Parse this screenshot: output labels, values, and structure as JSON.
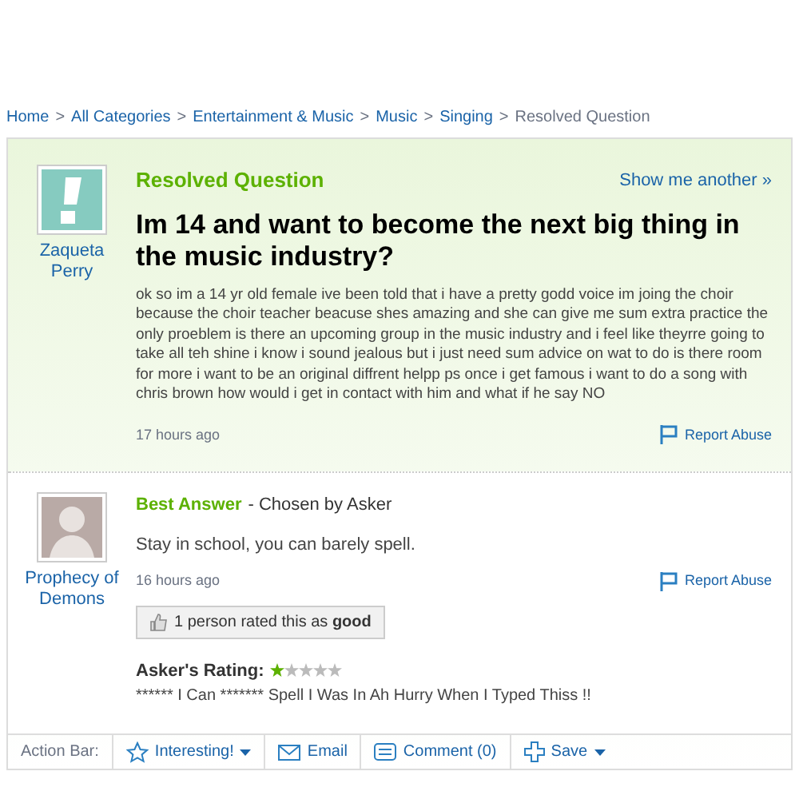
{
  "breadcrumbs": [
    {
      "label": "Home",
      "link": true
    },
    {
      "label": "All Categories",
      "link": true
    },
    {
      "label": "Entertainment & Music",
      "link": true
    },
    {
      "label": "Music",
      "link": true
    },
    {
      "label": "Singing",
      "link": true
    },
    {
      "label": "Resolved Question",
      "link": false
    }
  ],
  "separator": ">",
  "question": {
    "status": "Resolved Question",
    "show_another": "Show me another »",
    "asker": "Zaqueta Perry",
    "title": "Im 14 and want to become the next big thing in the music industry?",
    "body": "ok so im a 14 yr old female ive been told that i have a pretty godd voice im joing the choir because the choir teacher beacuse shes amazing and she can give me sum extra practice the only proeblem is there an upcoming group in the music industry and i feel like theyrre going to take all teh shine i know i sound jealous but i just need sum advice on wat to do is there room for more i want to be an original diffrent helpp ps once i get famous i want to do a song with chris brown how would i get in contact with him and what if he say NO",
    "time": "17 hours ago",
    "report": "Report Abuse"
  },
  "answer": {
    "label": "Best Answer",
    "chosen": "- Chosen by Asker",
    "author": "Prophecy of Demons",
    "body": "Stay in school, you can barely spell.",
    "time": "16 hours ago",
    "report": "Report Abuse",
    "rated": "1 person rated this as **good**",
    "rating_label": "Asker's Rating:",
    "stars": 1,
    "rating_comment": "****** I Can ******* Spell I Was In Ah Hurry When I Typed Thiss !!"
  },
  "action_bar": {
    "label": "Action Bar:",
    "actions": [
      {
        "label": "Interesting!",
        "kind": "dropdown"
      },
      {
        "label": "Email",
        "kind": "email"
      },
      {
        "label": "Comment (0)",
        "kind": "comment"
      },
      {
        "label": "Save",
        "kind": "save"
      }
    ]
  }
}
